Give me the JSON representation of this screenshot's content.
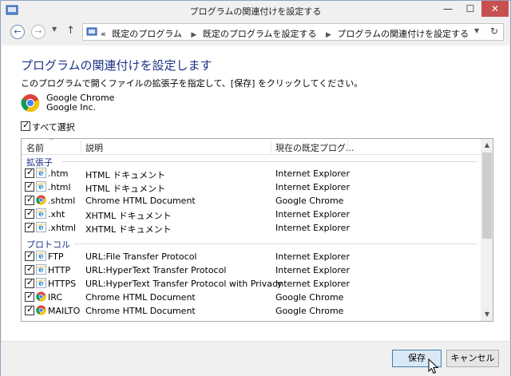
{
  "window": {
    "title": "プログラムの関連付けを設定する",
    "minimize": "—",
    "maximize": "☐",
    "close": "✕"
  },
  "nav": {
    "back": "←",
    "forward": "→",
    "history": "▼",
    "up": "↑",
    "crumb_prefix": "«",
    "crumbs": [
      "既定のプログラム",
      "既定のプログラムを設定する",
      "プログラムの関連付けを設定する"
    ],
    "crumb_separator": "▶",
    "dropdown": "▼",
    "refresh": "↻"
  },
  "page": {
    "heading": "プログラムの関連付けを設定します",
    "instruction": "このプログラムで開くファイルの拡張子を指定して、[保存] をクリックしてください。",
    "program_name": "Google Chrome",
    "program_company": "Google Inc.",
    "select_all": "すべて選択"
  },
  "list": {
    "columns": [
      "名前",
      "説明",
      "現在の既定プログ..."
    ],
    "sort_indicator": "^",
    "groups": [
      {
        "label": "拡張子",
        "rows": [
          {
            "name": ".htm",
            "desc": "HTML ドキュメント",
            "prog": "Internet Explorer",
            "icon": "ie-icon",
            "checked": true
          },
          {
            "name": ".html",
            "desc": "HTML ドキュメント",
            "prog": "Internet Explorer",
            "icon": "ie-icon",
            "checked": true
          },
          {
            "name": ".shtml",
            "desc": "Chrome HTML Document",
            "prog": "Google Chrome",
            "icon": "chrome-icon",
            "checked": true
          },
          {
            "name": ".xht",
            "desc": "XHTML ドキュメント",
            "prog": "Internet Explorer",
            "icon": "ie-icon",
            "checked": true
          },
          {
            "name": ".xhtml",
            "desc": "XHTML ドキュメント",
            "prog": "Internet Explorer",
            "icon": "ie-icon",
            "checked": true
          }
        ]
      },
      {
        "label": "プロトコル",
        "rows": [
          {
            "name": "FTP",
            "desc": "URL:File Transfer Protocol",
            "prog": "Internet Explorer",
            "icon": "ie-icon",
            "checked": true
          },
          {
            "name": "HTTP",
            "desc": "URL:HyperText Transfer Protocol",
            "prog": "Internet Explorer",
            "icon": "ie-icon",
            "checked": true
          },
          {
            "name": "HTTPS",
            "desc": "URL:HyperText Transfer Protocol with Privacy",
            "prog": "Internet Explorer",
            "icon": "ie-icon",
            "checked": true
          },
          {
            "name": "IRC",
            "desc": "Chrome HTML Document",
            "prog": "Google Chrome",
            "icon": "chrome-icon",
            "checked": true
          },
          {
            "name": "MAILTO",
            "desc": "Chrome HTML Document",
            "prog": "Google Chrome",
            "icon": "chrome-icon",
            "checked": true
          }
        ]
      }
    ],
    "scroll_up": "▲",
    "scroll_down": "▼"
  },
  "buttons": {
    "save": "保存",
    "cancel": "キャンセル"
  },
  "colors": {
    "heading": "#1e3287",
    "close_button": "#c75050",
    "ie_blue": "#1e88d8",
    "chrome_red": "#db4437",
    "chrome_yellow": "#f4c20d",
    "chrome_green": "#0f9d58",
    "chrome_blue": "#4285f4"
  }
}
